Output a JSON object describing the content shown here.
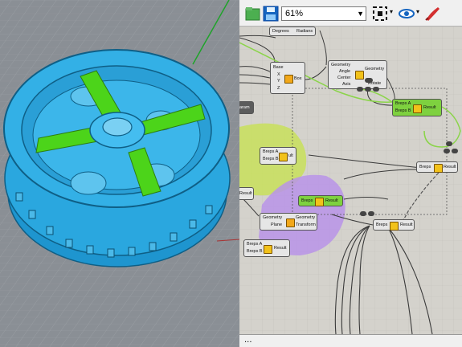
{
  "toolbar": {
    "zoom_value": "61%",
    "statusbar_text": "..."
  },
  "components": {
    "degrees_radians": {
      "in_label": "Degrees",
      "out_label": "Radians"
    },
    "box": {
      "inputs": [
        "Base",
        "X",
        "Y",
        "Z"
      ],
      "output": "Box"
    },
    "rotate": {
      "inputs": [
        "Geometry",
        "Angle",
        "Center",
        "Axis"
      ],
      "output": "Geometry",
      "output2": "Rotate"
    },
    "union_green_top": {
      "inputs": [
        "Breps A",
        "Breps B"
      ],
      "output": "Result"
    },
    "union_left": {
      "inputs": [
        "Breps A",
        "Breps B"
      ],
      "output": "Result"
    },
    "union_right": {
      "inputs": [
        "Breps",
        "Result"
      ]
    },
    "union_purple": {
      "inputs": [
        "Breps"
      ],
      "output": "Result"
    },
    "mirror": {
      "inputs": [
        "Geometry",
        "Plane"
      ],
      "outputs": [
        "Geometry",
        "Transform"
      ]
    },
    "union_bottom_left": {
      "inputs": [
        "Breps A",
        "Breps B"
      ],
      "output": "Result"
    },
    "union_bottom": {
      "input": "Breps",
      "output": "Result"
    },
    "param_left": {
      "label": "aram"
    },
    "result_left": {
      "label": "Result"
    },
    "result_mid": {
      "label": "ult"
    }
  },
  "colors": {
    "viewport_bg": "#8a8f95",
    "part_blue": "#2ba8e0",
    "part_green": "#4cd41a",
    "canvas_bg": "#d4d2cc",
    "group_green": "#c8e05a",
    "group_purple": "#b894e8",
    "wire_green": "#8bd44a"
  }
}
